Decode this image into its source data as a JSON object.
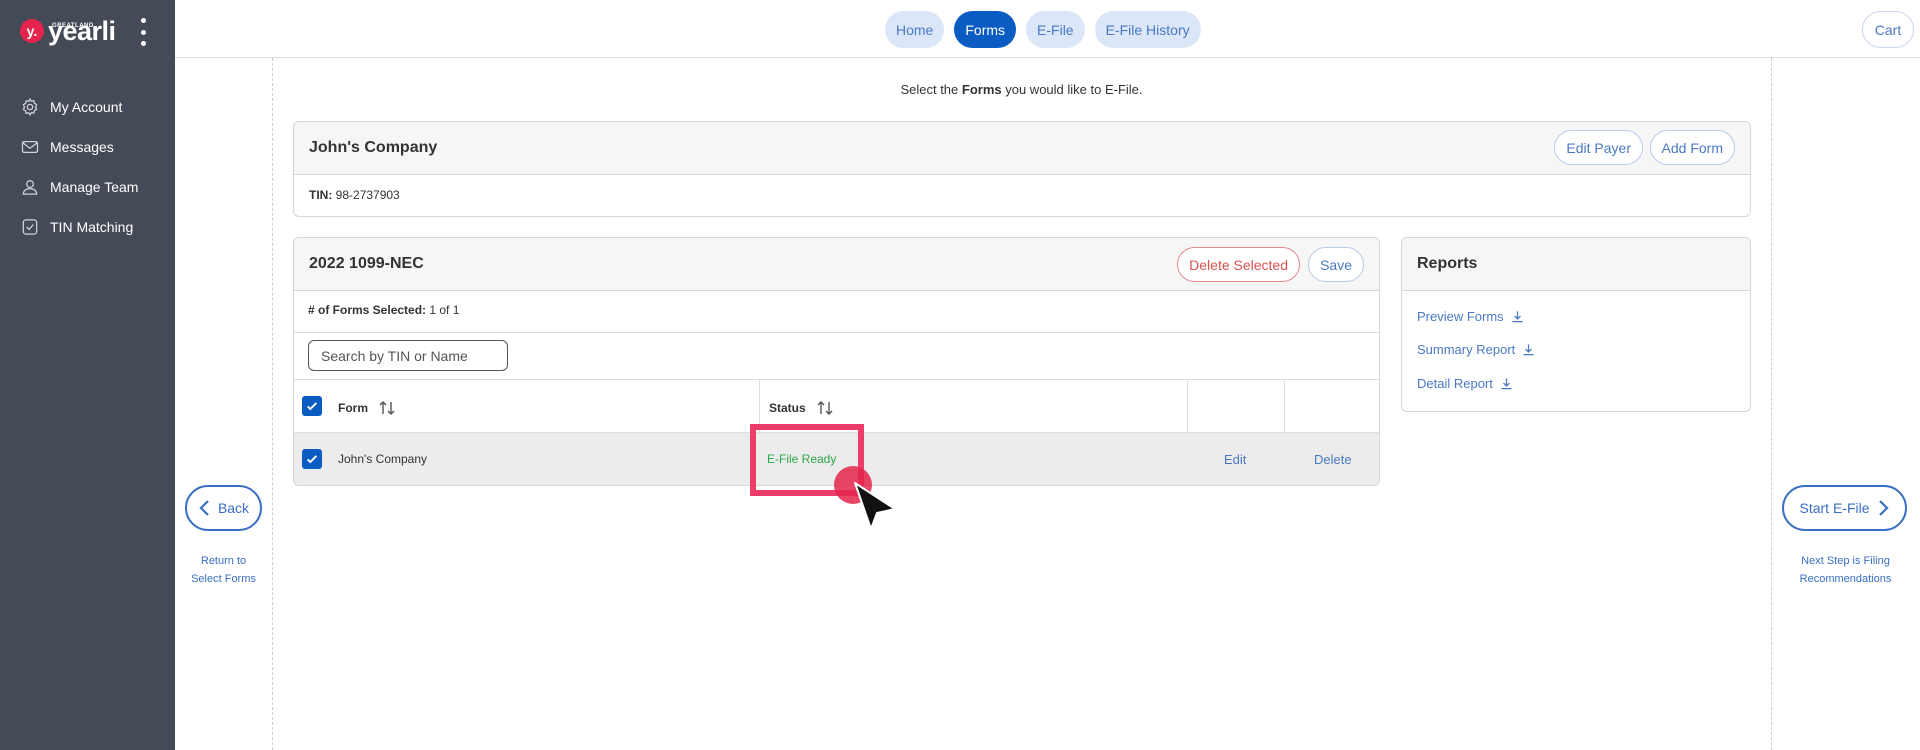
{
  "sidebar": {
    "brand": {
      "mark": "y.",
      "sub": "GREATLAND",
      "name": "yearli"
    },
    "items": [
      {
        "label": "My Account",
        "icon": "gear-icon"
      },
      {
        "label": "Messages",
        "icon": "envelope-icon"
      },
      {
        "label": "Manage Team",
        "icon": "user-icon"
      },
      {
        "label": "TIN Matching",
        "icon": "check-document-icon"
      }
    ]
  },
  "topnav": {
    "tabs": [
      {
        "label": "Home",
        "active": false
      },
      {
        "label": "Forms",
        "active": true
      },
      {
        "label": "E-File",
        "active": false
      },
      {
        "label": "E-File History",
        "active": false
      }
    ],
    "cart_label": "Cart"
  },
  "intro": {
    "prefix": "Select the ",
    "bold": "Forms",
    "suffix": " you would like to E-File."
  },
  "payer": {
    "name": "John's Company",
    "edit_label": "Edit Payer",
    "add_label": "Add Form",
    "tin_label": "TIN:",
    "tin_value": "98-2737903"
  },
  "forms": {
    "title": "2022 1099-NEC",
    "delete_selected_label": "Delete Selected",
    "save_label": "Save",
    "selected_label": "# of Forms Selected:",
    "selected_value": "1 of 1",
    "search_placeholder": "Search by TIN or Name",
    "columns": {
      "form": "Form",
      "status": "Status"
    },
    "row": {
      "name": "John's Company",
      "status": "E-File Ready",
      "edit": "Edit",
      "delete": "Delete"
    }
  },
  "reports": {
    "title": "Reports",
    "links": [
      "Preview Forms",
      "Summary Report",
      "Detail Report"
    ]
  },
  "back": {
    "label": "Back",
    "note_line1": "Return to",
    "note_line2": "Select Forms"
  },
  "next": {
    "label": "Start E-File",
    "note_line1": "Next Step is Filing",
    "note_line2": "Recommendations"
  },
  "colors": {
    "accent": "#0a5cc2",
    "sidebar": "#454a57",
    "status_ready": "#2ba84a",
    "danger": "#d9534f",
    "highlight": "#ec3d6a"
  }
}
